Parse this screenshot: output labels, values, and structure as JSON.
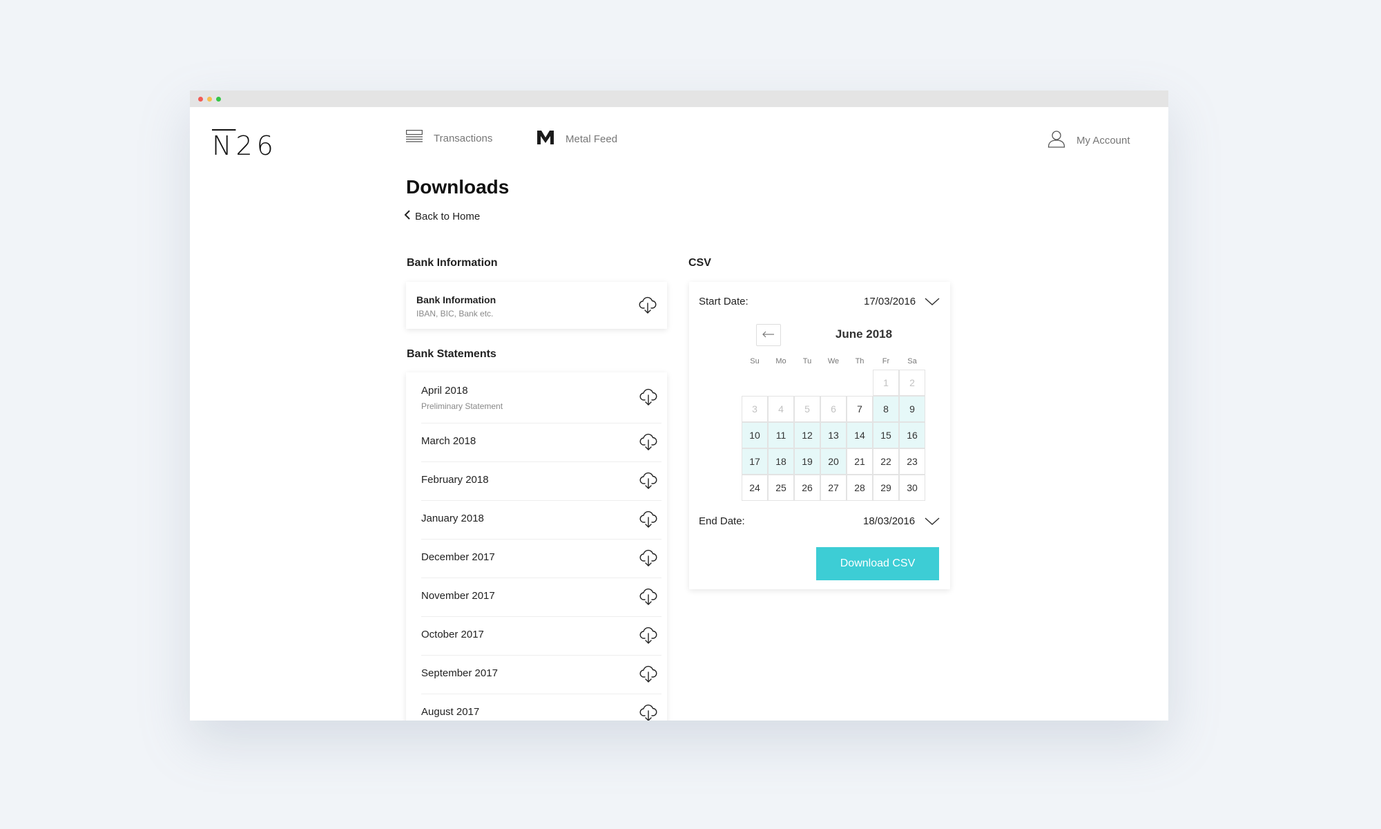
{
  "app": {
    "logo": "N26",
    "logo_rest": "26",
    "logo_n": "N"
  },
  "nav": {
    "transactions": "Transactions",
    "metal_feed": "Metal Feed",
    "my_account": "My Account"
  },
  "page": {
    "title": "Downloads",
    "back_label": "Back to Home"
  },
  "bank_information": {
    "heading": "Bank Information",
    "card_title": "Bank Information",
    "card_subtitle": "IBAN, BIC, Bank etc."
  },
  "bank_statements": {
    "heading": "Bank Statements",
    "items": [
      {
        "label": "April 2018",
        "sub": "Preliminary Statement"
      },
      {
        "label": "March 2018",
        "sub": ""
      },
      {
        "label": "February 2018",
        "sub": ""
      },
      {
        "label": "January 2018",
        "sub": ""
      },
      {
        "label": "December 2017",
        "sub": ""
      },
      {
        "label": "November 2017",
        "sub": ""
      },
      {
        "label": "October 2017",
        "sub": ""
      },
      {
        "label": "September 2017",
        "sub": ""
      },
      {
        "label": "August 2017",
        "sub": ""
      }
    ]
  },
  "csv": {
    "heading": "CSV",
    "start_label": "Start Date:",
    "start_value": "17/03/2016",
    "end_label": "End Date:",
    "end_value": "18/03/2016",
    "button_label": "Download CSV",
    "calendar": {
      "month_title": "June 2018",
      "weekdays": [
        "Su",
        "Mo",
        "Tu",
        "We",
        "Th",
        "Fr",
        "Sa"
      ],
      "weeks": [
        [
          "",
          "",
          "",
          "",
          "",
          "1",
          "2"
        ],
        [
          "3",
          "4",
          "5",
          "6",
          "7",
          "8",
          "9"
        ],
        [
          "10",
          "11",
          "12",
          "13",
          "14",
          "15",
          "16"
        ],
        [
          "17",
          "18",
          "19",
          "20",
          "21",
          "22",
          "23"
        ],
        [
          "24",
          "25",
          "26",
          "27",
          "28",
          "29",
          "30"
        ]
      ],
      "disabled_days": [
        "1",
        "2",
        "3",
        "4",
        "5",
        "6"
      ],
      "highlighted_days": [
        "8",
        "9",
        "10",
        "11",
        "12",
        "13",
        "14",
        "15",
        "16",
        "17",
        "18",
        "19",
        "20"
      ]
    }
  },
  "colors": {
    "accent": "#3dcdd5",
    "range_highlight": "#e6f8f8"
  }
}
